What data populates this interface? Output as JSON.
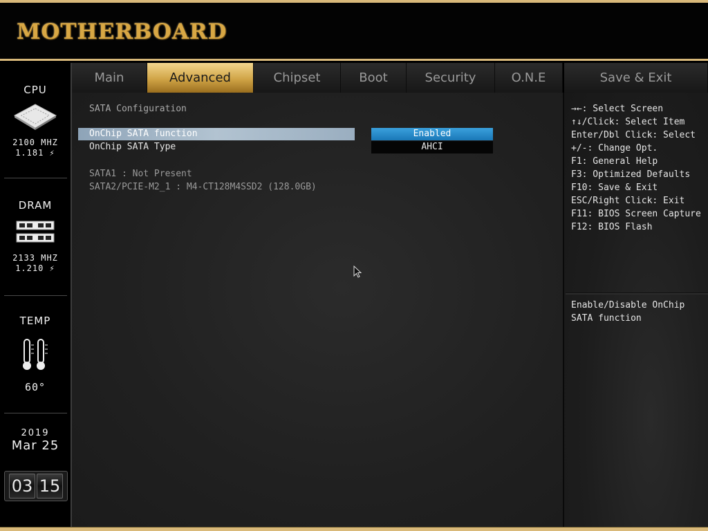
{
  "banner": {
    "logo_text": "MOTHERBOARD"
  },
  "status_panel": {
    "cpu": {
      "title": "CPU",
      "freq": "2100 MHZ",
      "voltage": "1.181 ⚡"
    },
    "dram": {
      "title": "DRAM",
      "freq": "2133 MHZ",
      "voltage": "1.210 ⚡"
    },
    "temp": {
      "title": "TEMP",
      "value": "60°"
    },
    "date": {
      "year": "2019",
      "month_day": "Mar 25"
    },
    "clock": {
      "hours": "03",
      "minutes": "15"
    }
  },
  "tabs": [
    {
      "label": "Main",
      "active": false
    },
    {
      "label": "Advanced",
      "active": true
    },
    {
      "label": "Chipset",
      "active": false
    },
    {
      "label": "Boot",
      "active": false
    },
    {
      "label": "Security",
      "active": false
    },
    {
      "label": "O.N.E",
      "active": false
    },
    {
      "label": "Save & Exit",
      "active": false
    }
  ],
  "main": {
    "section_title": "SATA Configuration",
    "options": [
      {
        "label": "OnChip SATA function",
        "value": "Enabled",
        "selected": true
      },
      {
        "label": "OnChip SATA Type",
        "value": "AHCI",
        "selected": false
      }
    ],
    "info": [
      "SATA1 : Not Present",
      "SATA2/PCIE-M2_1 : M4-CT128M4SSD2 (128.0GB)"
    ]
  },
  "help": {
    "keys": [
      "→←: Select Screen",
      "↑↓/Click: Select Item",
      "Enter/Dbl Click: Select",
      "+/-: Change Opt.",
      "F1: General Help",
      "F3: Optimized Defaults",
      "F10: Save & Exit",
      "ESC/Right Click: Exit",
      "F11: BIOS Screen Capture",
      "F12: BIOS Flash"
    ],
    "description": "Enable/Disable OnChip SATA function"
  },
  "colors": {
    "gold_accent": "#d9b97a",
    "active_tab": "#d0a446",
    "selected_value": "#1a78b8",
    "selected_row": "#a8bccc"
  }
}
